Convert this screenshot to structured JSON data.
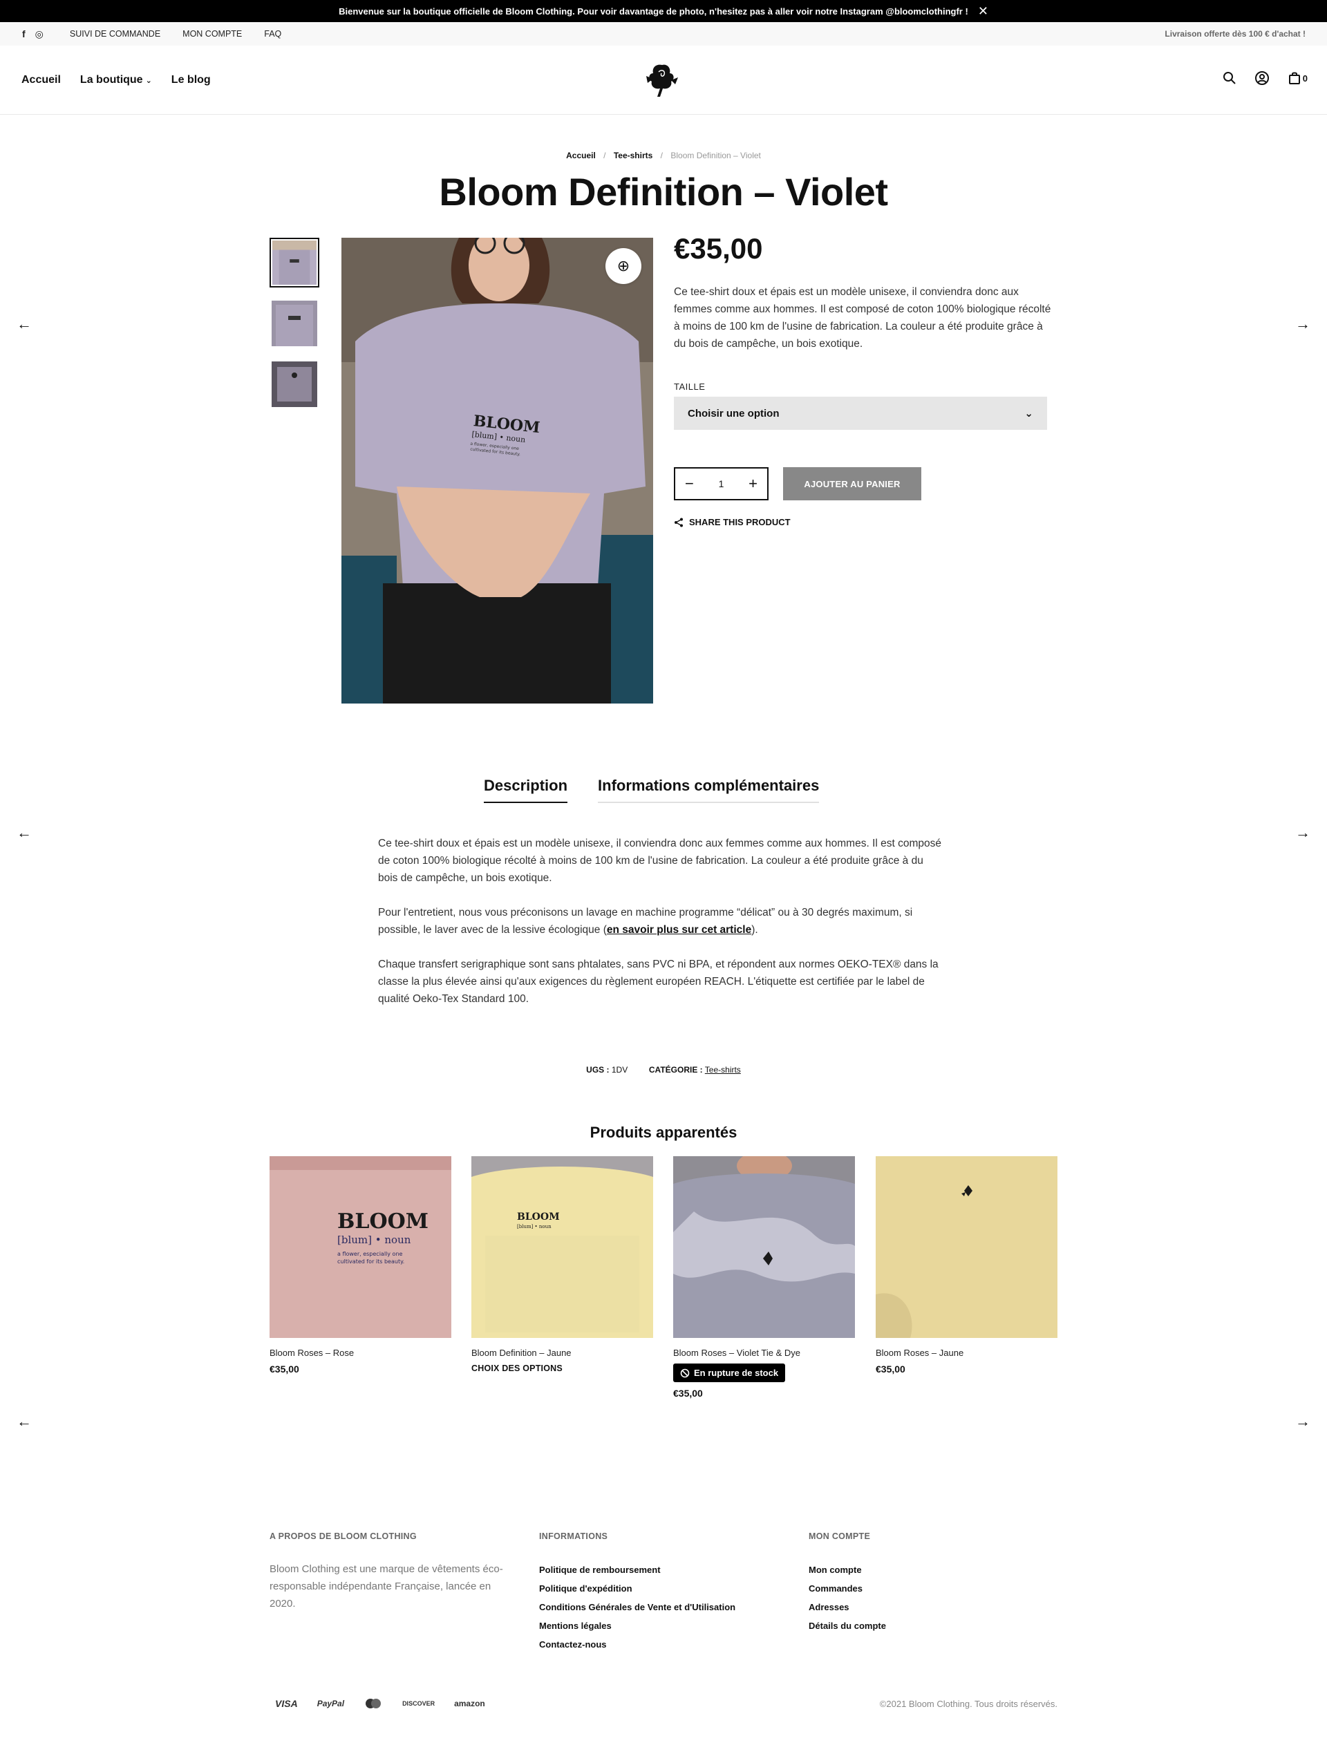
{
  "announcement": {
    "text": "Bienvenue sur la boutique officielle de Bloom Clothing. Pour voir davantage de photo, n'hesitez pas à aller voir notre Instagram @bloomclothingfr !",
    "close": "✕"
  },
  "topbar": {
    "social": [
      "f",
      "◎"
    ],
    "links": [
      "SUIVI DE COMMANDE",
      "MON COMPTE",
      "FAQ"
    ],
    "promo": "Livraison offerte dès 100 € d'achat !"
  },
  "nav": {
    "items": [
      {
        "label": "Accueil"
      },
      {
        "label": "La boutique",
        "caret": "⌄"
      },
      {
        "label": "Le blog"
      }
    ],
    "cart_count": "0"
  },
  "breadcrumb": {
    "items": [
      "Accueil",
      "Tee-shirts"
    ],
    "separator": "/",
    "current": "Bloom Definition – Violet"
  },
  "product": {
    "title": "Bloom Definition – Violet",
    "price": "€35,00",
    "short_description": "Ce tee-shirt doux et épais est un modèle unisexe, il conviendra donc aux femmes comme aux hommes. Il est composé de coton 100% biologique récolté à moins de 100 km de l'usine de fabrication. La couleur a été produite grâce à du bois de campêche, un bois exotique.",
    "size_label": "TAILLE",
    "size_placeholder": "Choisir une option",
    "quantity": "1",
    "add_to_cart": "AJOUTER AU PANIER",
    "share": "SHARE THIS PRODUCT",
    "image_print": {
      "line1": "BLOOM",
      "line2": "[blum] • noun",
      "line3": "a flower, especially one",
      "line4": "cultivated for its beauty."
    },
    "zoom_icon": "⊕"
  },
  "tabs": {
    "items": [
      "Description",
      "Informations complémentaires"
    ],
    "active": 0
  },
  "description": {
    "p1": "Ce tee-shirt doux et épais est un modèle unisexe, il conviendra donc aux femmes comme aux hommes. Il est composé de coton 100% biologique récolté à moins de 100 km de l'usine de fabrication. La couleur a été produite grâce à du bois de campêche, un bois exotique.",
    "p2_before": "Pour l'entretient, nous vous préconisons un lavage en machine programme “délicat” ou à 30 degrés maximum, si possible, le laver avec de la lessive écologique (",
    "p2_link": "en savoir plus sur cet article",
    "p2_after": ").",
    "p3": "Chaque transfert serigraphique sont sans phtalates, sans PVC ni BPA, et répondent aux normes OEKO-TEX® dans la classe la plus élevée ainsi qu'aux exigences du règlement européen REACH. L'étiquette est certifiée par le label de qualité Oeko-Tex Standard 100."
  },
  "meta": {
    "sku_label": "UGS :",
    "sku": "1DV",
    "category_label": "CATÉGORIE :",
    "category": "Tee-shirts"
  },
  "related": {
    "title": "Produits apparentés",
    "products": [
      {
        "name": "Bloom Roses – Rose",
        "price": "€35,00"
      },
      {
        "name": "Bloom Definition – Jaune",
        "options": "CHOIX DES OPTIONS"
      },
      {
        "name": "Bloom Roses – Violet Tie & Dye",
        "badge": "En rupture de stock",
        "price": "€35,00"
      },
      {
        "name": "Bloom Roses – Jaune",
        "price": "€35,00"
      }
    ],
    "card_print": {
      "line1": "BLOOM",
      "line2": "[blum] • noun",
      "line3": "a flower, especially one",
      "line4": "cultivated for its beauty."
    }
  },
  "footer": {
    "about_heading": "A PROPOS DE BLOOM CLOTHING",
    "about_text": "Bloom Clothing est une marque de vêtements éco-responsable indépendante Française, lancée en 2020.",
    "info_heading": "INFORMATIONS",
    "info_links": [
      "Politique de remboursement",
      "Politique d'expédition",
      "Conditions Générales de Vente et d'Utilisation",
      "Mentions légales",
      "Contactez-nous"
    ],
    "account_heading": "MON COMPTE",
    "account_links": [
      "Mon compte",
      "Commandes",
      "Adresses",
      "Détails du compte"
    ],
    "payments": [
      "VISA",
      "PayPal",
      "mastercard",
      "DISCOVER",
      "amazon"
    ],
    "copyright": "©2021 Bloom Clothing. Tous droits réservés."
  },
  "icons": {
    "arrow_left": "←",
    "arrow_right": "→",
    "minus": "−",
    "plus": "+",
    "chevron": "⌄"
  }
}
